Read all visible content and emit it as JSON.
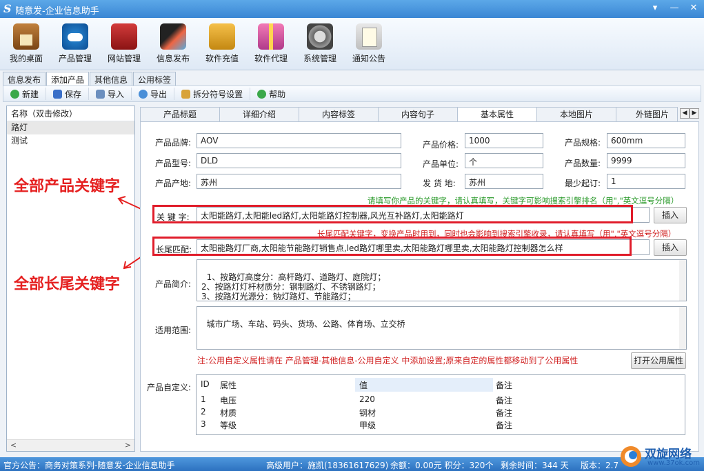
{
  "window": {
    "logo": "S",
    "title": "随意发-企业信息助手",
    "btns": [
      "▾",
      "—",
      "✕"
    ]
  },
  "toolbar": [
    {
      "label": "我的桌面",
      "icon": "house-icon"
    },
    {
      "label": "产品管理",
      "icon": "cloud-icon"
    },
    {
      "label": "网站管理",
      "icon": "website-icon"
    },
    {
      "label": "信息发布",
      "icon": "magic-wand-icon"
    },
    {
      "label": "软件充值",
      "icon": "coins-icon"
    },
    {
      "label": "软件代理",
      "icon": "gift-icon"
    },
    {
      "label": "系统管理",
      "icon": "gear-icon"
    },
    {
      "label": "通知公告",
      "icon": "notice-icon"
    }
  ],
  "subtabs": [
    "信息发布",
    "添加产品",
    "其他信息",
    "公用标签"
  ],
  "actions": [
    "新建",
    "保存",
    "导入",
    "导出",
    "拆分符号设置",
    "帮助"
  ],
  "left": {
    "header": "名称（双击修改）",
    "items": [
      "路灯",
      "测试"
    ]
  },
  "annotations": {
    "keywords": "全部产品关键字",
    "longtail": "全部长尾关键字"
  },
  "rtabs": [
    "产品标题",
    "详细介绍",
    "内容标签",
    "内容句子",
    "基本属性",
    "本地图片",
    "外链图片"
  ],
  "form": {
    "brand_label": "产品品牌:",
    "brand": "AOV",
    "model_label": "产品型号:",
    "model": "DLD",
    "origin_label": "产品产地:",
    "origin": "苏州",
    "price_label": "产品价格:",
    "price": "1000",
    "unit_label": "产品单位:",
    "unit": "个",
    "ship_label": "发 货 地:",
    "ship": "苏州",
    "spec_label": "产品规格:",
    "spec": "600mm",
    "qty_label": "产品数量:",
    "qty": "9999",
    "min_label": "最少起订:",
    "min": "1",
    "kw_hint": "请填写你产品的关键字，请认真填写，关键字可影响搜索引擎排名（用\",\"英文逗号分隔）",
    "kw_label": "关 键 字:",
    "kw": "太阳能路灯,太阳能led路灯,太阳能路灯控制器,风光互补路灯,太阳能路灯",
    "lt_hint": "长尾匹配关键字，变换产品时用到，同时也会影响到搜索引擎收录，请认真填写（用\",\"英文逗号分隔）",
    "lt_label": "长尾匹配:",
    "lt": "太阳能路灯厂商,太阳能节能路灯销售点,led路灯哪里卖,太阳能路灯哪里卖,太阳能路灯控制器怎么样",
    "insert": "插入",
    "intro_label": "产品简介:",
    "intro": "1、按路灯高度分：高杆路灯、道路灯、庭院灯；\n2、按路灯灯杆材质分：钢制路灯、不锈钢路灯；\n3、按路灯光源分：钠灯路灯、节能路灯；",
    "scope_label": "适用范围:",
    "scope": "城市广场、车站、码头、货场、公路、体育场、立交桥",
    "note": "注:公用自定义属性请在 产品管理-其他信息-公用自定义 中添加设置;原来自定的属性都移动到了公用属性",
    "open_public": "打开公用属性",
    "custom_label": "产品自定义:"
  },
  "grid": {
    "headers": [
      "ID",
      "属性",
      "值",
      "备注"
    ],
    "rows": [
      [
        "1",
        "电压",
        "220",
        "备注"
      ],
      [
        "2",
        "材质",
        "钢材",
        "备注"
      ],
      [
        "3",
        "等级",
        "甲级",
        "备注"
      ]
    ]
  },
  "status": {
    "notice": "官方公告：商务对策系列-随意发-企业信息助手",
    "user": "高级用户：施凯(18361617629)",
    "balance": "余额：0.00元 积分：320个",
    "remain": "剩余时间：344 天",
    "version": "版本：2.7",
    "watermark": "双旋网络",
    "watermark_url": "www.37ok.com"
  }
}
